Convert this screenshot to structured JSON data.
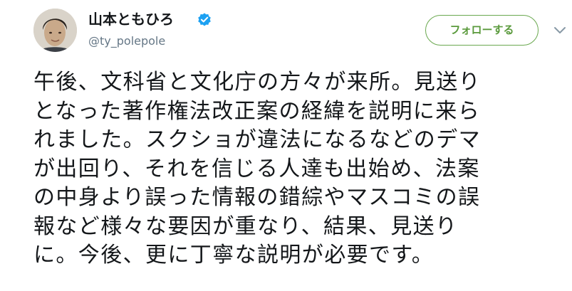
{
  "author": {
    "display_name": "山本ともひろ",
    "handle": "@ty_polepole",
    "verified": true,
    "verified_icon": "verified-badge-icon",
    "avatar_icon": "profile-photo"
  },
  "follow_button": {
    "label": "フォローする"
  },
  "menu": {
    "icon": "chevron-down-icon"
  },
  "tweet": {
    "lines": [
      "午後、文科省と文化庁の方々が来所。見送り",
      "となった著作権法改正案の経緯を説明に来ら",
      "れました。スクショが違法になるなどのデマ",
      "が出回り、それを信じる人達も出始め、法案",
      "の中身より誤った情報の錯綜やマスコミの誤",
      "報など様々な要因が重なり、結果、見送り",
      "に。今後、更に丁寧な説明が必要です。"
    ]
  },
  "colors": {
    "text": "#14171a",
    "secondary_text": "#657786",
    "verified_blue": "#1da1f2",
    "follow_green": "#5a9a3c"
  }
}
